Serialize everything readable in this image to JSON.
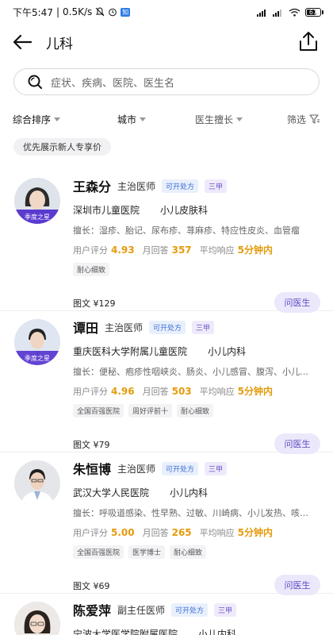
{
  "status_bar": {
    "time": "下午5:47",
    "network_speed": "0.5K/s",
    "battery": "61"
  },
  "nav": {
    "title": "儿科"
  },
  "search": {
    "placeholder": "症状、疾病、医院、医生名"
  },
  "filters": {
    "sort": "综合排序",
    "city": "城市",
    "specialty": "医生擅长",
    "filter": "筛选"
  },
  "promo": "优先展示新人专享价",
  "doctors": [
    {
      "name": "王森分",
      "title": "主治医师",
      "tags": [
        "可开处方",
        "三甲"
      ],
      "hospital": "深圳市儿童医院",
      "department": "小儿皮肤科",
      "specialty": "擅长：湿疹、胎记、尿布疹、荨麻疹、特应性皮炎、血管瘤",
      "rating_label": "用户评分",
      "rating": "4.93",
      "monthly_label": "月回答",
      "monthly": "357",
      "response_label": "平均响应",
      "response": "5分钟内",
      "badges": [
        "耐心细致"
      ],
      "price": "图文 ¥129",
      "button": "问医生",
      "avatar_label": "季度之星"
    },
    {
      "name": "谭田",
      "title": "主治医师",
      "tags": [
        "可开处方",
        "三甲"
      ],
      "hospital": "重庆医科大学附属儿童医院",
      "department": "小儿内科",
      "specialty": "擅长：便秘、疱疹性咽峡炎、肠炎、小儿感冒、腹泻、小儿…",
      "rating_label": "用户评分",
      "rating": "4.96",
      "monthly_label": "月回答",
      "monthly": "503",
      "response_label": "平均响应",
      "response": "5分钟内",
      "badges": [
        "全国百强医院",
        "周好评前十",
        "耐心细致"
      ],
      "price": "图文 ¥79",
      "button": "问医生",
      "avatar_label": "季度之星"
    },
    {
      "name": "朱恒博",
      "title": "主治医师",
      "tags": [
        "可开处方",
        "三甲"
      ],
      "hospital": "武汉大学人民医院",
      "department": "小儿内科",
      "specialty": "擅长：呼吸道感染、性早熟、过敏、川崎病、小儿发热、咳…",
      "rating_label": "用户评分",
      "rating": "5.00",
      "monthly_label": "月回答",
      "monthly": "265",
      "response_label": "平均响应",
      "response": "5分钟内",
      "badges": [
        "全国百强医院",
        "医学博士",
        "耐心细致"
      ],
      "price": "图文 ¥69",
      "button": "问医生"
    },
    {
      "name": "陈爱萍",
      "title": "副主任医师",
      "tags": [
        "可开处方",
        "三甲"
      ],
      "hospital": "宁波大学医学院附属医院",
      "department": "小儿内科"
    }
  ]
}
